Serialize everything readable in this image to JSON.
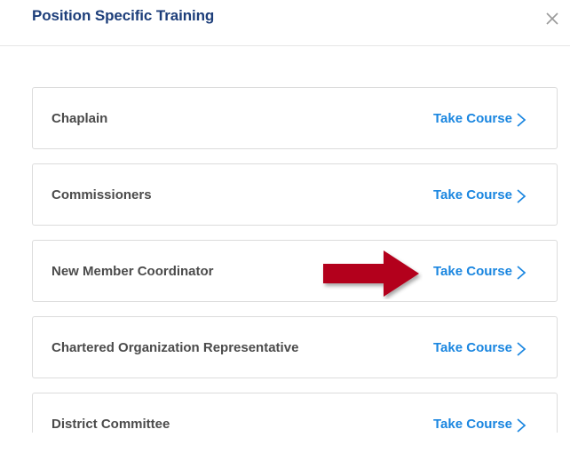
{
  "dialog": {
    "title": "Position Specific Training",
    "close_icon": "close-icon"
  },
  "courses": [
    {
      "name": "Chaplain",
      "action": "Take Course"
    },
    {
      "name": "Commissioners",
      "action": "Take Course"
    },
    {
      "name": "New Member Coordinator",
      "action": "Take Course"
    },
    {
      "name": "Chartered Organization Representative",
      "action": "Take Course"
    },
    {
      "name": "District Committee",
      "action": "Take Course"
    }
  ],
  "annotation": {
    "icon": "red-arrow-icon",
    "color": "#b3001b"
  },
  "colors": {
    "title": "#1d3e7a",
    "link": "#1a86e0",
    "course_text": "#4b4b4b"
  }
}
